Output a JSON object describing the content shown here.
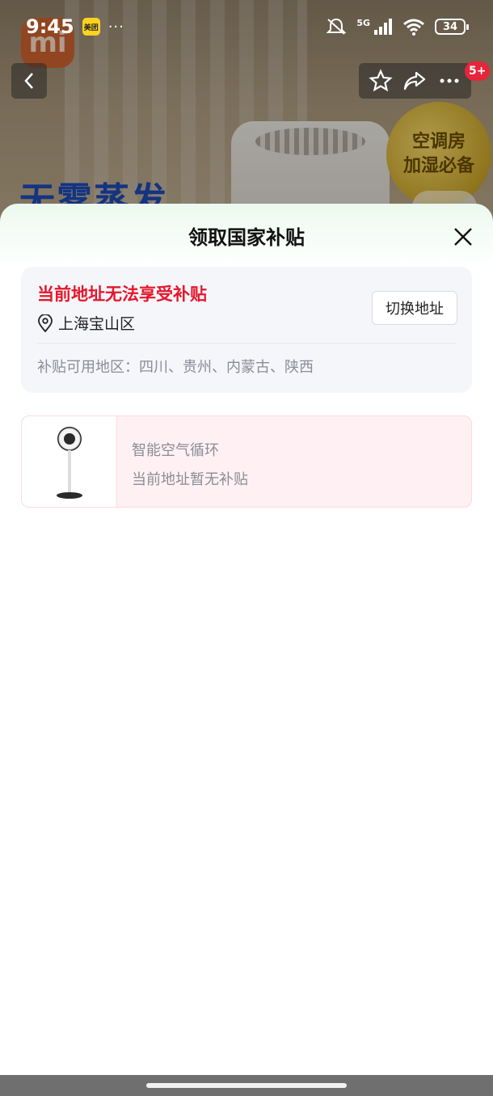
{
  "status_bar": {
    "time": "9:45",
    "app_chip": "美团",
    "network": "5G",
    "battery": "34"
  },
  "background": {
    "brand_logo": "mi",
    "headline": "无雾蒸发",
    "badge_line1": "空调房",
    "badge_line2": "加湿必备"
  },
  "nav": {
    "cart_count": "5+"
  },
  "sheet": {
    "title": "领取国家补贴",
    "address_card": {
      "warning": "当前地址无法享受补贴",
      "address": "上海宝山区",
      "switch_label": "切换地址",
      "region_label": "补贴可用地区：",
      "regions": "四川、贵州、内蒙古、陕西"
    },
    "product": {
      "name": "智能空气循环",
      "status": "当前地址暂无补贴"
    }
  },
  "colors": {
    "warning_red": "#e5162b",
    "sheet_tint": "#ecf9ef",
    "product_card_bg": "#fff1f3"
  }
}
